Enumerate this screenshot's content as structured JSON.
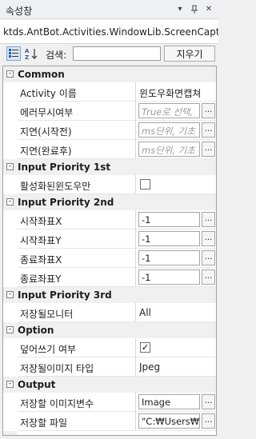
{
  "panel": {
    "title": "속성창"
  },
  "object_name": "ktds.AntBot.Activities.WindowLib.ScreenCaptu",
  "toolbar": {
    "search_label": "검색:",
    "search_value": "",
    "clear_label": "지우기"
  },
  "categories": {
    "common": {
      "label": "Common",
      "toggle": "-"
    },
    "ip1": {
      "label": "Input Priority 1st",
      "toggle": "-"
    },
    "ip2": {
      "label": "Input Priority 2nd",
      "toggle": "-"
    },
    "ip3": {
      "label": "Input Priority 3rd",
      "toggle": "-"
    },
    "option": {
      "label": "Option",
      "toggle": "-"
    },
    "output": {
      "label": "Output",
      "toggle": "-"
    }
  },
  "props": {
    "activity_name": {
      "name": "Activity 이름",
      "value": "윈도우화면캡쳐"
    },
    "error_ignore": {
      "name": "에러무시여부",
      "placeholder": "True로 선택,",
      "button": "..."
    },
    "delay_before": {
      "name": "지연(시작전)",
      "placeholder": "ms단위, 기초",
      "button": "..."
    },
    "delay_after": {
      "name": "지연(완료후)",
      "placeholder": "ms단위, 기초",
      "button": "..."
    },
    "active_window": {
      "name": "활성화된윈도우만",
      "checked": ""
    },
    "start_x": {
      "name": "시작좌표X",
      "value": "-1",
      "button": "..."
    },
    "start_y": {
      "name": "시작좌표Y",
      "value": "-1",
      "button": "..."
    },
    "end_x": {
      "name": "종료좌표X",
      "value": "-1",
      "button": "..."
    },
    "end_y": {
      "name": "종료좌표Y",
      "value": "-1",
      "button": "..."
    },
    "monitor": {
      "name": "저장될모니터",
      "value": "All"
    },
    "overwrite": {
      "name": "덮어쓰기 여부",
      "checked": "✓"
    },
    "image_type": {
      "name": "저장될이미지 타입",
      "value": "Jpeg"
    },
    "image_var": {
      "name": "저장할 이미지변수",
      "value": "Image",
      "button": "..."
    },
    "save_file": {
      "name": "저장할 파일",
      "value": "\"C:₩Users₩u",
      "button": "..."
    }
  }
}
